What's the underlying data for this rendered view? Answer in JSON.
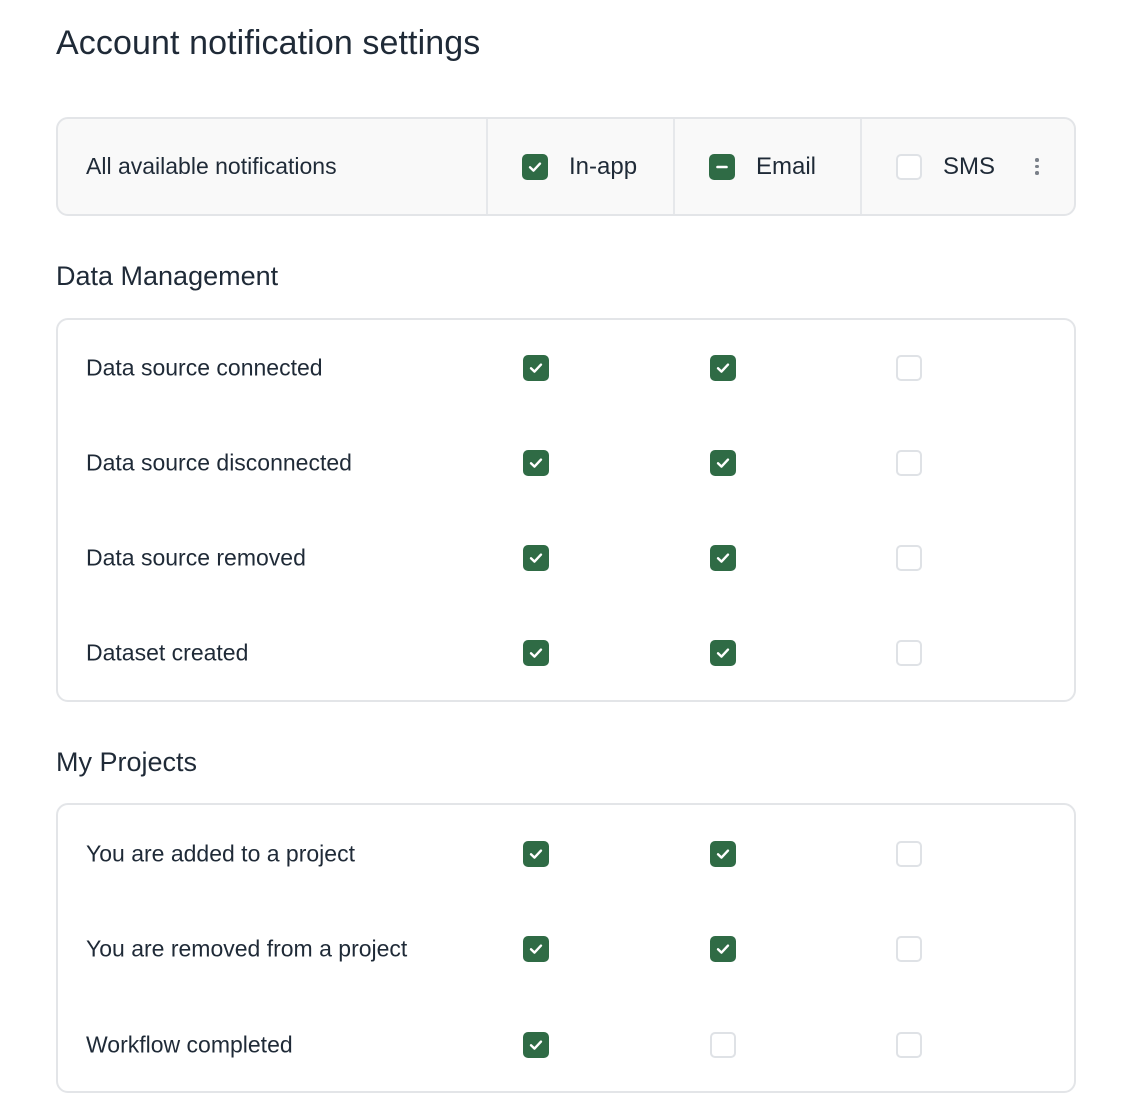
{
  "page": {
    "title": "Account notification settings"
  },
  "header": {
    "label": "All available notifications",
    "channels": [
      {
        "label": "In-app",
        "state": "checked"
      },
      {
        "label": "Email",
        "state": "partial"
      },
      {
        "label": "SMS",
        "state": "unchecked"
      }
    ]
  },
  "groups": [
    {
      "title": "Data Management",
      "rows": [
        {
          "label": "Data source connected",
          "in_app": true,
          "email": true,
          "sms": false
        },
        {
          "label": "Data source disconnected",
          "in_app": true,
          "email": true,
          "sms": false
        },
        {
          "label": "Data source removed",
          "in_app": true,
          "email": true,
          "sms": false
        },
        {
          "label": "Dataset created",
          "in_app": true,
          "email": true,
          "sms": false
        }
      ]
    },
    {
      "title": "My Projects",
      "rows": [
        {
          "label": "You are added to a project",
          "in_app": true,
          "email": true,
          "sms": false
        },
        {
          "label": "You are removed from a project",
          "in_app": true,
          "email": true,
          "sms": false
        },
        {
          "label": "Workflow completed",
          "in_app": true,
          "email": false,
          "sms": false
        }
      ]
    }
  ],
  "colors": {
    "accent": "#2f6b45",
    "border": "#e3e5e8",
    "text": "#1f2a37",
    "header_bg": "#f9f9f9"
  },
  "icons": {
    "check": "checkmark-icon",
    "partial": "minus-icon",
    "more": "more-vertical-icon"
  }
}
